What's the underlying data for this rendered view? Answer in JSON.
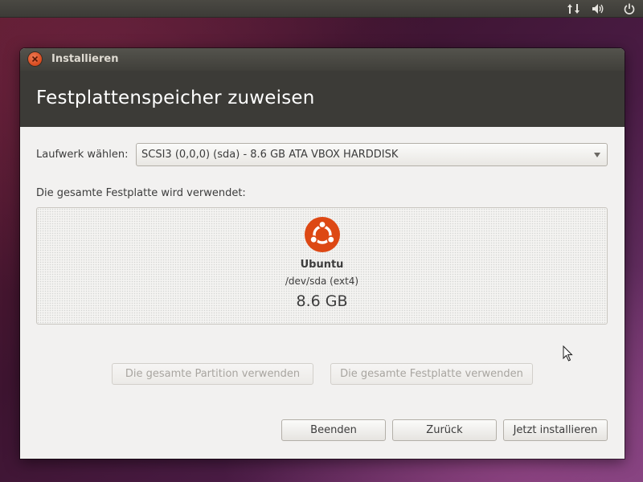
{
  "window": {
    "title": "Installieren"
  },
  "header": {
    "title": "Festplattenspeicher zuweisen"
  },
  "drive": {
    "label": "Laufwerk wählen:",
    "selected": "SCSI3 (0,0,0) (sda) - 8.6 GB ATA VBOX HARDDISK"
  },
  "disk": {
    "caption": "Die gesamte Festplatte wird verwendet:",
    "partition": {
      "name": "Ubuntu",
      "device": "/dev/sda (ext4)",
      "size": "8.6 GB"
    }
  },
  "options": {
    "use_partition": "Die gesamte Partition verwenden",
    "use_disk": "Die gesamte Festplatte verwenden"
  },
  "actions": {
    "quit": "Beenden",
    "back": "Zurück",
    "install": "Jetzt installieren"
  },
  "icons": {
    "network": "network-arrows-icon",
    "volume": "volume-icon",
    "power": "power-icon",
    "ubuntu": "ubuntu-logo-icon"
  },
  "colors": {
    "accent": "#dd4814",
    "header": "#3c3b37"
  }
}
